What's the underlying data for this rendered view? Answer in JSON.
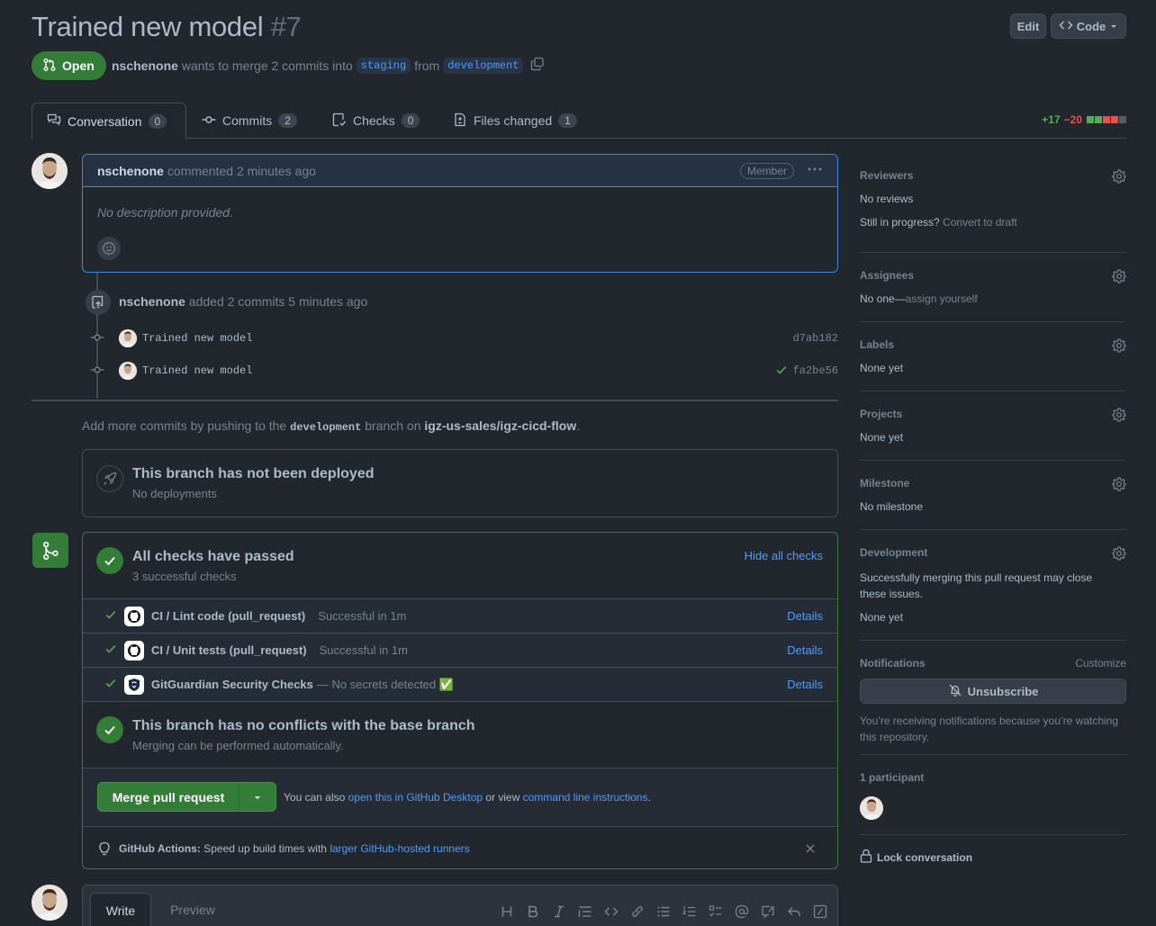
{
  "pr": {
    "title": "Trained new model",
    "number": "#7",
    "state": "Open",
    "author": "nschenone",
    "merge_text_1": "wants to merge 2 commits into",
    "base_branch": "staging",
    "merge_text_2": "from",
    "head_branch": "development"
  },
  "header_buttons": {
    "edit": "Edit",
    "code": "Code"
  },
  "tabs": [
    {
      "label": "Conversation",
      "count": "0"
    },
    {
      "label": "Commits",
      "count": "2"
    },
    {
      "label": "Checks",
      "count": "0"
    },
    {
      "label": "Files changed",
      "count": "1"
    }
  ],
  "diffstat": {
    "additions": "+17",
    "deletions": "−20"
  },
  "comment": {
    "author": "nschenone",
    "action": "commented 2 minutes ago",
    "role": "Member",
    "body": "No description provided."
  },
  "commits_event": {
    "author": "nschenone",
    "action": "added 2 commits 5 minutes ago",
    "commits": [
      {
        "message": "Trained new model",
        "sha": "d7ab182"
      },
      {
        "message": "Trained new model",
        "sha": "fa2be56"
      }
    ]
  },
  "push_hint": {
    "prefix": "Add more commits by pushing to the",
    "branch": "development",
    "middle": "branch on",
    "repo": "igz-us-sales/igz-cicd-flow",
    "suffix": "."
  },
  "deploy": {
    "title": "This branch has not been deployed",
    "subtitle": "No deployments"
  },
  "checks": {
    "title": "All checks have passed",
    "subtitle": "3 successful checks",
    "toggle": "Hide all checks",
    "items": [
      {
        "name": "CI / Lint code (pull_request)",
        "status": "Successful in 1m",
        "link": "Details"
      },
      {
        "name": "CI / Unit tests (pull_request)",
        "status": "Successful in 1m",
        "link": "Details"
      },
      {
        "name": "GitGuardian Security Checks",
        "status": "— No secrets detected ✅",
        "link": "Details"
      }
    ]
  },
  "conflicts": {
    "title": "This branch has no conflicts with the base branch",
    "subtitle": "Merging can be performed automatically."
  },
  "merge": {
    "button": "Merge pull request",
    "text1": "You can also",
    "link1": "open this in GitHub Desktop",
    "text2": "or view",
    "link2": "command line instructions",
    "text3": "."
  },
  "actions_tip": {
    "label": "GitHub Actions:",
    "text": "Speed up build times with",
    "link": "larger GitHub-hosted runners"
  },
  "composer": {
    "write_tab": "Write",
    "preview_tab": "Preview"
  },
  "sidebar": {
    "reviewers": {
      "title": "Reviewers",
      "value": "No reviews",
      "hint": "Still in progress?",
      "hint_link": "Convert to draft"
    },
    "assignees": {
      "title": "Assignees",
      "value": "No one—",
      "link": "assign yourself"
    },
    "labels": {
      "title": "Labels",
      "value": "None yet"
    },
    "projects": {
      "title": "Projects",
      "value": "None yet"
    },
    "milestone": {
      "title": "Milestone",
      "value": "No milestone"
    },
    "development": {
      "title": "Development",
      "text": "Successfully merging this pull request may close these issues.",
      "value": "None yet"
    },
    "notifications": {
      "title": "Notifications",
      "customize": "Customize",
      "button": "Unsubscribe",
      "text": "You’re receiving notifications because you’re watching this repository."
    },
    "participants": {
      "title": "1 participant"
    },
    "lock": "Lock conversation"
  },
  "colors": {
    "background": "#22272e",
    "accent_green": "#347d39",
    "link_blue": "#539bf5",
    "comment_blue": "#4184e4"
  }
}
